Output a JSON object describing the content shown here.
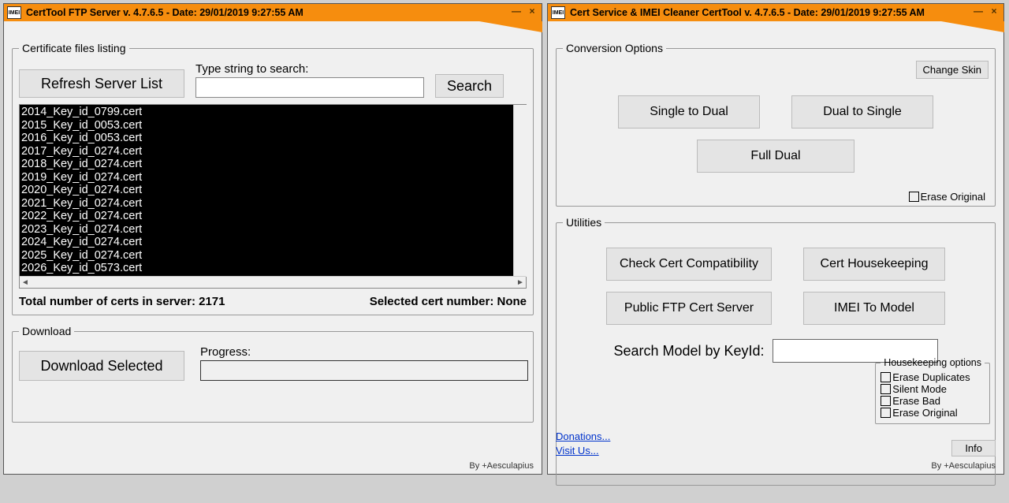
{
  "left_window": {
    "title": "CertTool FTP Server v. 4.7.6.5 - Date: 29/01/2019 9:27:55 AM",
    "listing_group_label": "Certificate files listing",
    "refresh_btn": "Refresh Server List",
    "search_label": "Type string to search:",
    "search_value": "",
    "search_btn": "Search",
    "cert_files": [
      "2014_Key_id_0799.cert",
      "2015_Key_id_0053.cert",
      "2016_Key_id_0053.cert",
      "2017_Key_id_0274.cert",
      "2018_Key_id_0274.cert",
      "2019_Key_id_0274.cert",
      "2020_Key_id_0274.cert",
      "2021_Key_id_0274.cert",
      "2022_Key_id_0274.cert",
      "2023_Key_id_0274.cert",
      "2024_Key_id_0274.cert",
      "2025_Key_id_0274.cert",
      "2026_Key_id_0573.cert"
    ],
    "total_prefix": "Total number of certs in server: ",
    "total_count": "2171",
    "selected_prefix": "Selected cert number: ",
    "selected_value": "None",
    "download_group_label": "Download",
    "download_btn": "Download Selected",
    "progress_label": "Progress:",
    "credits": "By +Aesculapius"
  },
  "right_window": {
    "title": "Cert Service & IMEI Cleaner CertTool v. 4.7.6.5 - Date: 29/01/2019 9:27:55 AM",
    "conversion_group_label": "Conversion Options",
    "change_skin_btn": "Change Skin",
    "single_to_dual_btn": "Single to Dual",
    "dual_to_single_btn": "Dual to Single",
    "full_dual_btn": "Full Dual",
    "erase_original_chk": "Erase Original",
    "utilities_group_label": "Utilities",
    "check_cert_btn": "Check Cert Compatibility",
    "cert_housekeeping_btn": "Cert Housekeeping",
    "public_ftp_btn": "Public FTP Cert Server",
    "imei_to_model_btn": "IMEI To Model",
    "search_model_label": "Search Model by KeyId:",
    "search_model_value": "",
    "housekeep_group_label": "Housekeeping options",
    "erase_duplicates_chk": "Erase Duplicates",
    "silent_mode_chk": "Silent Mode",
    "erase_bad_chk": "Erase Bad",
    "erase_original2_chk": "Erase Original",
    "donations_link": "Donations...",
    "visit_link": "Visit Us...",
    "info_btn": "Info",
    "credits": "By +Aesculapius"
  }
}
